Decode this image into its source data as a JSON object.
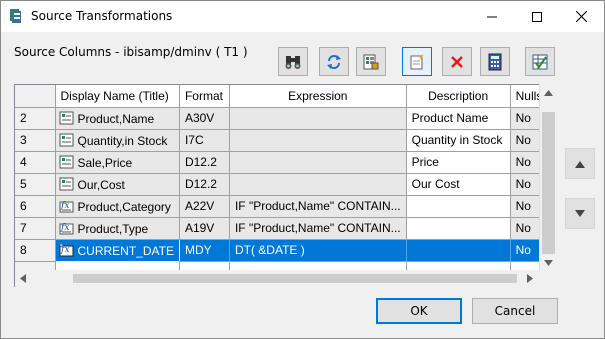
{
  "window": {
    "title": "Source Transformations",
    "controls": {
      "minimize": "—",
      "maximize": "☐",
      "close": "✕"
    }
  },
  "source_label": "Source Columns - ibisamp/dminv ( T1 )",
  "toolbar": {
    "buttons": [
      {
        "icon": "binoculars-icon"
      },
      {
        "icon": "refresh-icon"
      },
      {
        "icon": "properties-icon"
      },
      {
        "icon": "new-column-icon",
        "active": true
      },
      {
        "icon": "delete-icon"
      },
      {
        "icon": "calculator-icon"
      },
      {
        "icon": "check-table-icon"
      }
    ]
  },
  "grid": {
    "columns": [
      "Display Name (Title)",
      "Format",
      "Expression",
      "Description",
      "Nulls"
    ],
    "rows": [
      {
        "num": "2",
        "name": "Product,Name",
        "format": "A30V",
        "expression": "",
        "description": "Product Name",
        "nulls": "No",
        "icon": "field-icon"
      },
      {
        "num": "3",
        "name": "Quantity,in Stock",
        "format": "I7C",
        "expression": "",
        "description": "Quantity in Stock",
        "nulls": "No",
        "icon": "field-icon"
      },
      {
        "num": "4",
        "name": "Sale,Price",
        "format": "D12.2",
        "expression": "",
        "description": "Price",
        "nulls": "No",
        "icon": "field-icon"
      },
      {
        "num": "5",
        "name": "Our,Cost",
        "format": "D12.2",
        "expression": "",
        "description": "Our Cost",
        "nulls": "No",
        "icon": "field-icon"
      },
      {
        "num": "6",
        "name": "Product,Category",
        "format": "A22V",
        "expression": "IF \"Product,Name\" CONTAIN...",
        "description": "",
        "nulls": "No",
        "icon": "computed-field-icon"
      },
      {
        "num": "7",
        "name": "Product,Type",
        "format": "A19V",
        "expression": "IF \"Product,Name\" CONTAIN...",
        "description": "",
        "nulls": "No",
        "icon": "computed-field-icon"
      },
      {
        "num": "8",
        "name": "CURRENT_DATE",
        "format": "MDY",
        "expression": "DT( &DATE )",
        "description": "",
        "nulls": "No",
        "icon": "new-computed-field-icon",
        "selected": true
      }
    ]
  },
  "side": {
    "move_up_icon": "move-up-icon",
    "move_down_icon": "move-down-icon"
  },
  "footer": {
    "ok_label": "OK",
    "cancel_label": "Cancel"
  }
}
